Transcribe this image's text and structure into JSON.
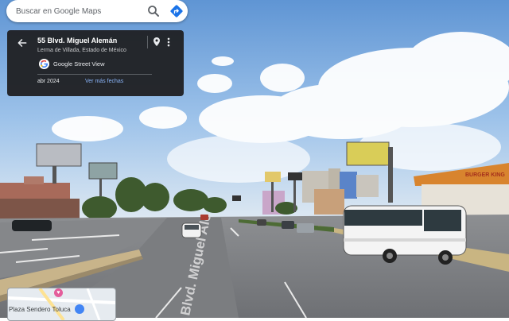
{
  "search": {
    "placeholder": "Buscar en Google Maps"
  },
  "location_card": {
    "address": "55 Blvd. Miguel Alemán",
    "locality": "Lerma de Villada, Estado de México",
    "source": "Google Street View",
    "date": "abr 2024",
    "more_dates_link": "Ver más fechas"
  },
  "street_view": {
    "road_marking": "Blvd. Miguel Ale",
    "signs": {
      "restaurant_sign": "BURGER KING"
    }
  },
  "minimap": {
    "poi_label": "Plaza Sendero Toluca"
  },
  "colors": {
    "card_background": "#202124",
    "link_color": "#8ab4f8",
    "directions_blue": "#4285f4",
    "poi_pink": "#e45d9b"
  },
  "icons": [
    "search-icon",
    "directions-icon",
    "back-arrow-icon",
    "location-pin-icon",
    "more-vert-icon",
    "google-logo-icon",
    "poi-pin-icon",
    "shop-icon"
  ]
}
